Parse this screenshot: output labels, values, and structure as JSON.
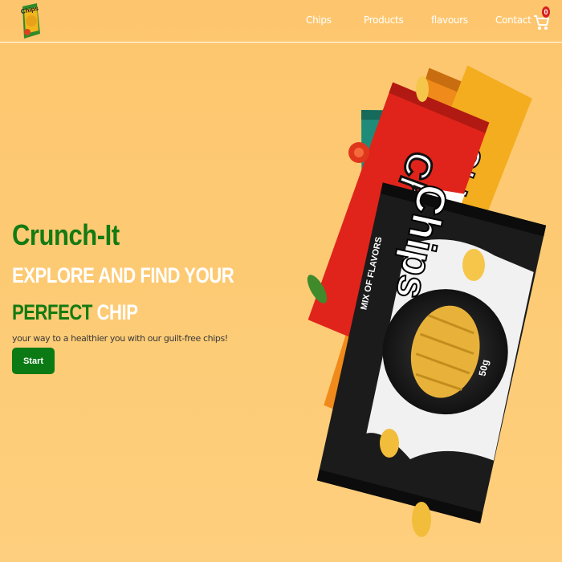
{
  "nav": {
    "logo_text": "Chips",
    "links": [
      {
        "label": "Chips"
      },
      {
        "label": "Products"
      },
      {
        "label": "flavours"
      },
      {
        "label": "Contact"
      }
    ],
    "cart_count": "0"
  },
  "hero": {
    "brand": "Crunch-It",
    "headline_line1": "EXPLORE AND FIND YOUR",
    "headline_line2_green": "PERFECT",
    "headline_line2_white": " CHIP",
    "tagline": "your way to a healthier you with our guilt-free chips!",
    "start_label": "Start",
    "bag": {
      "brand": "Chips",
      "flavor": "MIX OF FLAVORS",
      "weight": "50g"
    }
  },
  "colors": {
    "background": "#FDC66E",
    "brand_green": "#147a12",
    "button_green": "#0b7a14",
    "badge_red": "#d7201d"
  }
}
